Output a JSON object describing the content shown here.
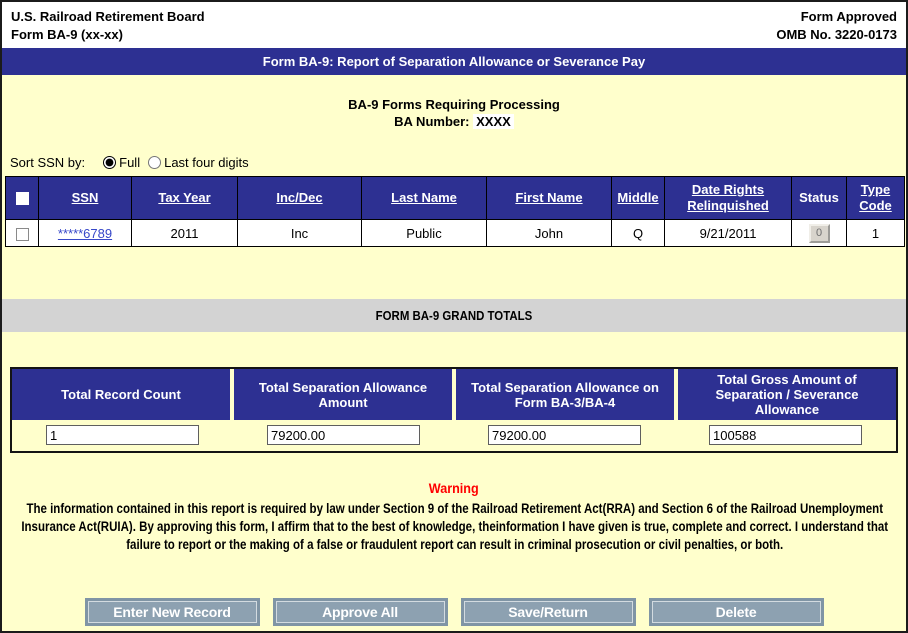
{
  "header": {
    "org_name": "U.S. Railroad Retirement Board",
    "form_id": "Form BA-9 (xx-xx)",
    "approved_label": "Form Approved",
    "omb_number": "OMB No. 3220-0173"
  },
  "title_bar": {
    "title": "Form BA-9: Report of Separation Allowance or Severance Pay"
  },
  "subtitle": {
    "heading": "BA-9 Forms Requiring Processing",
    "ba_number_label": "BA Number:",
    "ba_number_value": "XXXX"
  },
  "sort_controls": {
    "label": "Sort SSN by:",
    "options": [
      {
        "label": "Full",
        "selected": true
      },
      {
        "label": "Last four digits",
        "selected": false
      }
    ]
  },
  "records_table": {
    "headers": [
      {
        "label": "SSN"
      },
      {
        "label": "Tax Year"
      },
      {
        "label": "Inc/Dec"
      },
      {
        "label": "Last Name"
      },
      {
        "label": "First Name"
      },
      {
        "label": "Middle"
      },
      {
        "label": "Date Rights Relinquished"
      },
      {
        "label": "Status"
      },
      {
        "label": "Type Code"
      }
    ],
    "row": {
      "ssn": "*****6789",
      "tax_year": "2011",
      "inc_dec": "Inc",
      "last_name": "Public",
      "first_name": "John",
      "middle": "Q",
      "date_rights_relinquished": "9/21/2011",
      "status": "0",
      "type_code": "1"
    }
  },
  "grand_totals": {
    "bar_label": "FORM BA-9 GRAND TOTALS",
    "columns": [
      {
        "header": "Total Record Count",
        "value": "1"
      },
      {
        "header": "Total Separation Allowance Amount",
        "value": "79200.00"
      },
      {
        "header": "Total Separation Allowance on Form BA-3/BA-4",
        "value": "79200.00"
      },
      {
        "header": "Total Gross Amount of Separation / Severance Allowance",
        "value": "100588"
      }
    ]
  },
  "warning": {
    "title": "Warning",
    "body": "The information contained in this report is required by law under Section 9 of the Railroad Retirement Act(RRA) and Section 6 of the Railroad Unemployment Insurance Act(RUIA). By approving this form, I affirm that to the best of knowledge, theinformation I have given is true, complete and correct. I understand that failure to report or the making of a false or fraudulent report can result in criminal prosecution or civil penalties, or both."
  },
  "action_buttons": [
    {
      "label": "Enter New Record"
    },
    {
      "label": "Approve All"
    },
    {
      "label": "Save/Return"
    },
    {
      "label": "Delete"
    }
  ],
  "colors": {
    "navy": "#2D3092",
    "page_background": "#FFFFCC",
    "grand_totals_bar": "#D3D3D3",
    "button_fill": "#8DA1B1",
    "warning_red": "#FF0000",
    "link_blue": "#3647C8"
  }
}
